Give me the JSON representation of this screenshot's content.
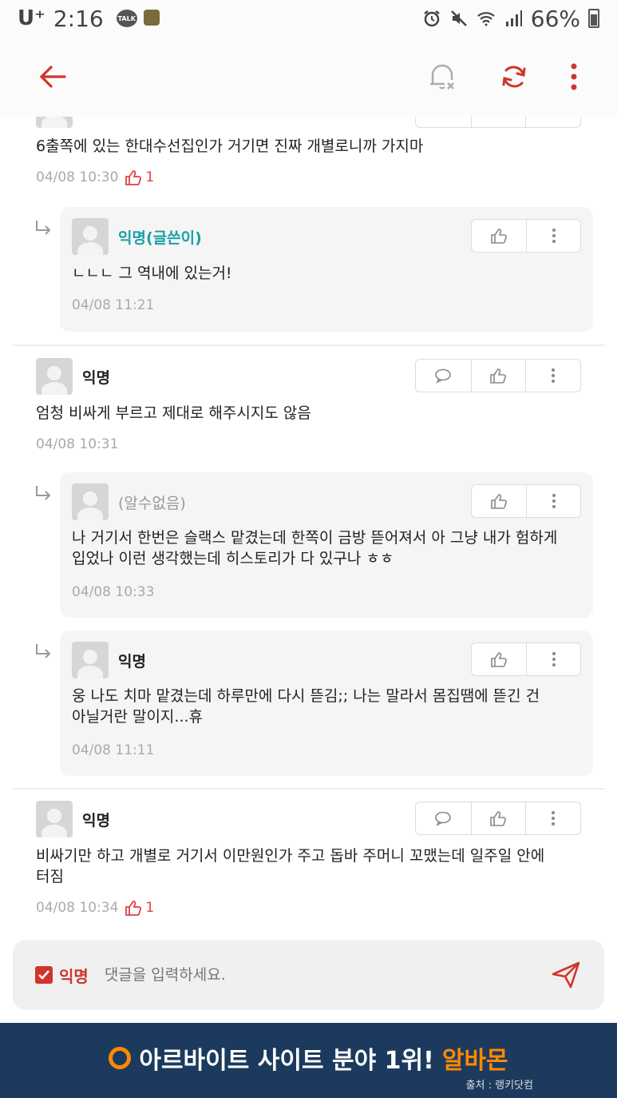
{
  "status_bar": {
    "carrier": "U⁺",
    "time": "2:16",
    "talk_badge": "TALK",
    "battery": "66%"
  },
  "comments": [
    {
      "text": "6출쪽에 있는 한대수선집인가 거기면 진짜 개별로니까 가지마",
      "time": "04/08 10:30",
      "likes": "1",
      "replies": [
        {
          "author": "익명(글쓴이)",
          "text": "ㄴㄴㄴ 그 역내에 있는거!",
          "time": "04/08 11:21"
        }
      ]
    },
    {
      "author": "익명",
      "text": "엄청 비싸게 부르고 제대로 해주시지도 않음",
      "time": "04/08 10:31",
      "replies": [
        {
          "author": "(알수없음)",
          "text_lines": [
            "나 거기서 한번은 슬랙스 맡겼는데 한쪽이 금방 뜯어져서 아 그냥 내가 험하게",
            "입었나 이런 생각했는데 히스토리가 다 있구나 ㅎㅎ"
          ],
          "time": "04/08 10:33"
        },
        {
          "author": "익명",
          "text_lines": [
            "웅 나도 치마 맡겼는데 하루만에 다시 뜯김;; 나는 말라서 몸집땜에 뜯긴 건",
            "아닐거란 말이지...휴"
          ],
          "time": "04/08 11:11"
        }
      ]
    },
    {
      "author": "익명",
      "text_lines": [
        "비싸기만 하고 개별로 거기서 이만원인가 주고 돕바 주머니 꼬맸는데 일주일 안에",
        "터짐"
      ],
      "time": "04/08 10:34",
      "likes": "1"
    }
  ],
  "input": {
    "anon_label": "익명",
    "placeholder": "댓글을 입력하세요."
  },
  "banner": {
    "main": "아르바이트 사이트 분야 1위!",
    "brand": "알바몬",
    "source": "출처 : 랭키닷컴"
  },
  "colors": {
    "accent": "#d0342c",
    "op_author": "#1aa0a6",
    "banner_bg": "#1c3a5e",
    "banner_brand": "#ff8a00"
  }
}
